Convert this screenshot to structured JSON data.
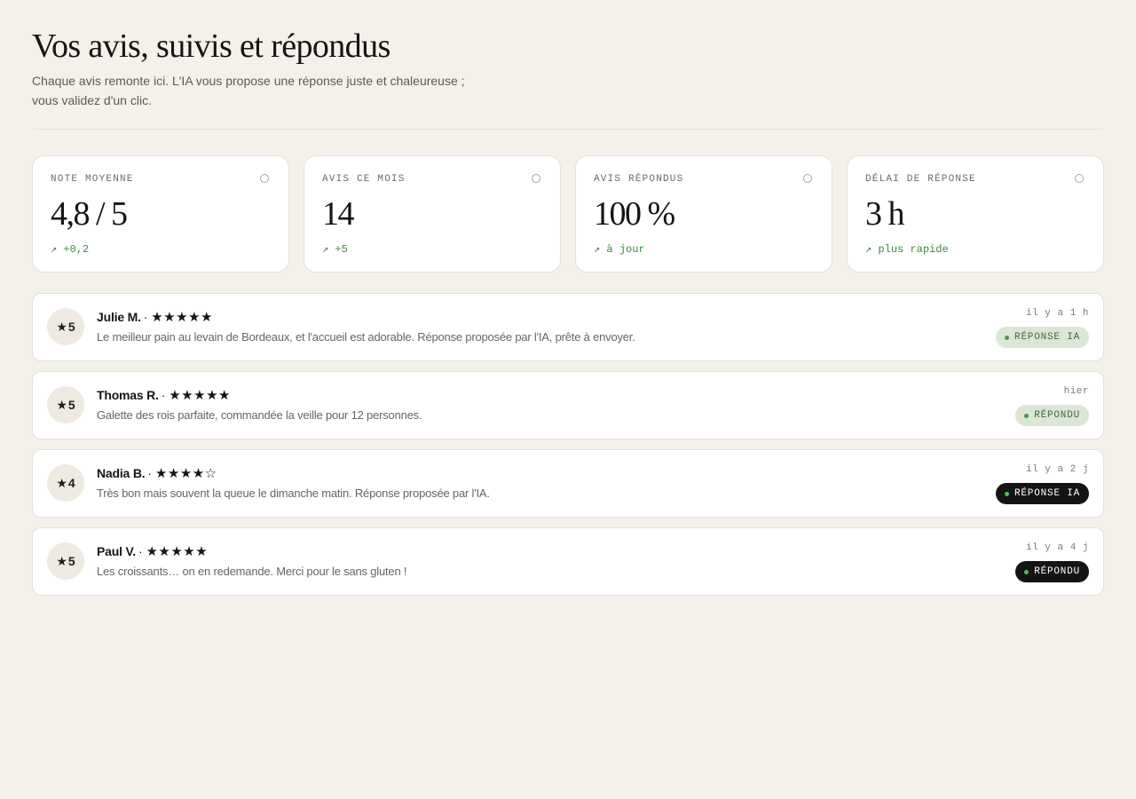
{
  "header": {
    "title": "Vos avis, suivis et répondus",
    "subtitle": "Chaque avis remonte ici. L'IA vous propose une réponse juste et chaleureuse ; vous validez d'un clic."
  },
  "stats": [
    {
      "label": "NOTE MOYENNE",
      "value": "4,8 / 5",
      "trend": "↗ +0,2"
    },
    {
      "label": "AVIS CE MOIS",
      "value": "14",
      "trend": "↗ +5"
    },
    {
      "label": "AVIS RÉPONDUS",
      "value": "100 %",
      "trend": "↗ à jour"
    },
    {
      "label": "DÉLAI DE RÉPONSE",
      "value": "3 h",
      "trend": "↗ plus rapide"
    }
  ],
  "reviews": [
    {
      "rating": "5",
      "name": "Julie M.",
      "separator": "·",
      "stars": "★★★★★",
      "text": "Le meilleur pain au levain de Bordeaux, et l'accueil est adorable. Réponse proposée par l'IA, prête à envoyer.",
      "time": "il y a 1 h",
      "status": "RÉPONSE IA",
      "badge_style": "light"
    },
    {
      "rating": "5",
      "name": "Thomas R.",
      "separator": "·",
      "stars": "★★★★★",
      "text": "Galette des rois parfaite, commandée la veille pour 12 personnes.",
      "time": "hier",
      "status": "RÉPONDU",
      "badge_style": "light"
    },
    {
      "rating": "4",
      "name": "Nadia B.",
      "separator": "·",
      "stars": "★★★★☆",
      "text": "Très bon mais souvent la queue le dimanche matin. Réponse proposée par l'IA.",
      "time": "il y a 2 j",
      "status": "RÉPONSE IA",
      "badge_style": "dark"
    },
    {
      "rating": "5",
      "name": "Paul V.",
      "separator": "·",
      "stars": "★★★★★",
      "text": "Les croissants… on en redemande. Merci pour le sans gluten !",
      "time": "il y a 4 j",
      "status": "RÉPONDU",
      "badge_style": "dark"
    }
  ],
  "icons": {
    "stat_indicator": "circle-outline-icon",
    "avatar_star": "★",
    "trend": "arrow-up-right-icon"
  },
  "colors": {
    "background": "#f4f1ea",
    "trend_green": "#3d8a3f",
    "badge_light_bg": "#dce6d5",
    "badge_dark_bg": "#141414"
  }
}
